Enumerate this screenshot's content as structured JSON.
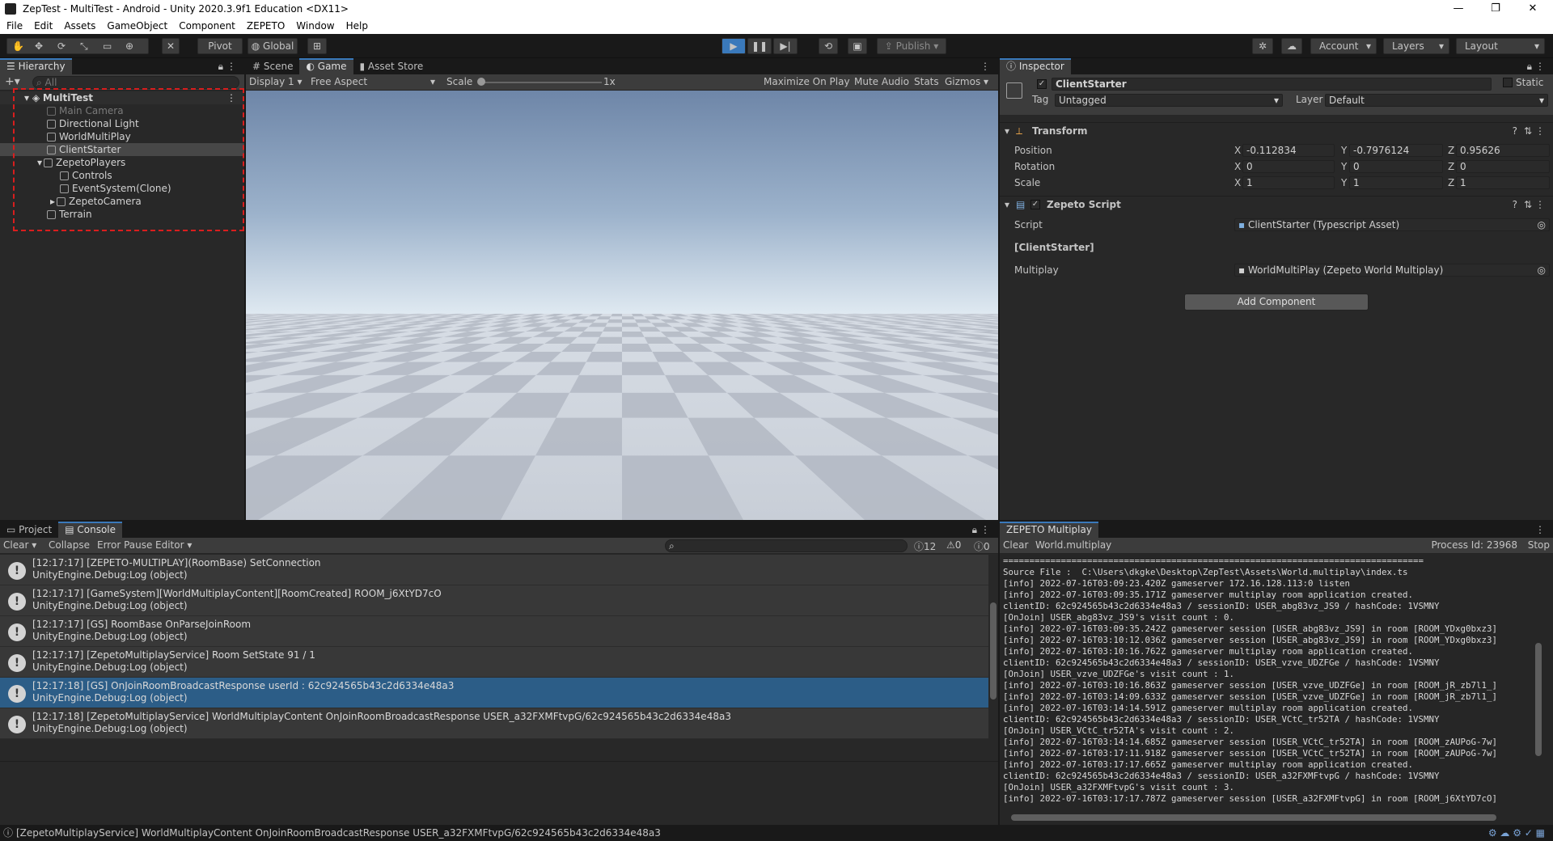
{
  "window": {
    "title": "ZepTest - MultiTest - Android - Unity 2020.3.9f1 Education <DX11>",
    "controls": [
      "—",
      "❐",
      "✕"
    ]
  },
  "menu": [
    "File",
    "Edit",
    "Assets",
    "GameObject",
    "Component",
    "ZEPETO",
    "Window",
    "Help"
  ],
  "toolbar": {
    "pivot": "Pivot",
    "global": "Global",
    "publish": "Publish",
    "account": "Account",
    "layers": "Layers",
    "layout": "Layout"
  },
  "hierarchy": {
    "tab": "Hierarchy",
    "search_placeholder": "All",
    "scene": "MultiTest",
    "items": [
      {
        "label": "Main Camera"
      },
      {
        "label": "Directional Light"
      },
      {
        "label": "WorldMultiPlay"
      },
      {
        "label": "ClientStarter"
      },
      {
        "label": "ZepetoPlayers"
      },
      {
        "label": "Controls"
      },
      {
        "label": "EventSystem(Clone)"
      },
      {
        "label": "ZepetoCamera"
      },
      {
        "label": "Terrain"
      }
    ]
  },
  "game_view": {
    "tabs": [
      "Scene",
      "Game",
      "Asset Store"
    ],
    "display": "Display 1",
    "aspect": "Free Aspect",
    "scale_label": "Scale",
    "scale_value": "1x",
    "options": [
      "Maximize On Play",
      "Mute Audio",
      "Stats",
      "Gizmos"
    ]
  },
  "inspector": {
    "tab": "Inspector",
    "object_name": "ClientStarter",
    "static_label": "Static",
    "tag_label": "Tag",
    "tag_value": "Untagged",
    "layer_label": "Layer",
    "layer_value": "Default",
    "transform": {
      "title": "Transform",
      "position_label": "Position",
      "rotation_label": "Rotation",
      "scale_label": "Scale",
      "position": {
        "x": "-0.112834",
        "y": "-0.7976124",
        "z": "0.95626"
      },
      "rotation": {
        "x": "0",
        "y": "0",
        "z": "0"
      },
      "scale": {
        "x": "1",
        "y": "1",
        "z": "1"
      }
    },
    "zepeto_script": {
      "title": "Zepeto Script",
      "script_label": "Script",
      "script_value": "ClientStarter (Typescript Asset)",
      "section": "[ClientStarter]",
      "multiplay_label": "Multiplay",
      "multiplay_value": "WorldMultiPlay (Zepeto World Multiplay)"
    },
    "add_component": "Add Component"
  },
  "console": {
    "tabs": [
      "Project",
      "Console"
    ],
    "buttons": [
      "Clear",
      "Collapse",
      "Error Pause",
      "Editor"
    ],
    "counts": {
      "log": "12",
      "warn": "0",
      "error": "0"
    },
    "entries": [
      {
        "line1": "[12:17:17] [ZEPETO-MULTIPLAY](RoomBase) SetConnection",
        "line2": "UnityEngine.Debug:Log (object)"
      },
      {
        "line1": "[12:17:17] [GameSystem][WorldMultiplayContent][RoomCreated] ROOM_j6XtYD7cO",
        "line2": "UnityEngine.Debug:Log (object)"
      },
      {
        "line1": "[12:17:17] [GS] RoomBase OnParseJoinRoom",
        "line2": "UnityEngine.Debug:Log (object)"
      },
      {
        "line1": "[12:17:17] [ZepetoMultiplayService] Room SetState 91 / 1",
        "line2": "UnityEngine.Debug:Log (object)"
      },
      {
        "line1": "[12:17:18] [GS] OnJoinRoomBroadcastResponse userId : 62c924565b43c2d6334e48a3",
        "line2": "UnityEngine.Debug:Log (object)"
      },
      {
        "line1": "[12:17:18] [ZepetoMultiplayService] WorldMultiplayContent OnJoinRoomBroadcastResponse USER_a32FXMFtvpG/62c924565b43c2d6334e48a3",
        "line2": "UnityEngine.Debug:Log (object)"
      }
    ]
  },
  "multiplay": {
    "tab": "ZEPETO Multiplay",
    "clear": "Clear",
    "file": "World.multiplay",
    "process_id": "Process Id: 23968",
    "stop": "Stop",
    "lines": [
      "================================================================================",
      "Source File :  C:\\Users\\dkgke\\Desktop\\ZepTest\\Assets\\World.multiplay\\index.ts",
      "[info] 2022-07-16T03:09:23.420Z gameserver 172.16.128.113:0 listen",
      "[info] 2022-07-16T03:09:35.171Z gameserver multiplay room application created.",
      "clientID: 62c924565b43c2d6334e48a3 / sessionID: USER_abg83vz_JS9 / hashCode: 1VSMNY",
      "[OnJoin] USER_abg83vz_JS9's visit count : 0.",
      "[info] 2022-07-16T03:09:35.242Z gameserver session [USER_abg83vz_JS9] in room [ROOM_YDxg0bxz3]",
      "[info] 2022-07-16T03:10:12.036Z gameserver session [USER_abg83vz_JS9] in room [ROOM_YDxg0bxz3]",
      "[info] 2022-07-16T03:10:16.762Z gameserver multiplay room application created.",
      "clientID: 62c924565b43c2d6334e48a3 / sessionID: USER_vzve_UDZFGe / hashCode: 1VSMNY",
      "[OnJoin] USER_vzve_UDZFGe's visit count : 1.",
      "[info] 2022-07-16T03:10:16.863Z gameserver session [USER_vzve_UDZFGe] in room [ROOM_jR_zb7l1_]",
      "[info] 2022-07-16T03:14:09.633Z gameserver session [USER_vzve_UDZFGe] in room [ROOM_jR_zb7l1_]",
      "[info] 2022-07-16T03:14:14.591Z gameserver multiplay room application created.",
      "clientID: 62c924565b43c2d6334e48a3 / sessionID: USER_VCtC_tr52TA / hashCode: 1VSMNY",
      "[OnJoin] USER_VCtC_tr52TA's visit count : 2.",
      "[info] 2022-07-16T03:14:14.685Z gameserver session [USER_VCtC_tr52TA] in room [ROOM_zAUPoG-7w]",
      "[info] 2022-07-16T03:17:11.918Z gameserver session [USER_VCtC_tr52TA] in room [ROOM_zAUPoG-7w]",
      "[info] 2022-07-16T03:17:17.665Z gameserver multiplay room application created.",
      "clientID: 62c924565b43c2d6334e48a3 / sessionID: USER_a32FXMFtvpG / hashCode: 1VSMNY",
      "[OnJoin] USER_a32FXMFtvpG's visit count : 3.",
      "[info] 2022-07-16T03:17:17.787Z gameserver session [USER_a32FXMFtvpG] in room [ROOM_j6XtYD7cO]"
    ]
  },
  "status_bar": "[ZepetoMultiplayService] WorldMultiplayContent OnJoinRoomBroadcastResponse USER_a32FXMFtvpG/62c924565b43c2d6334e48a3",
  "colors": {
    "selection": "#2c5d87",
    "highlight_box": "#d91e1e",
    "tab_accent": "#3a79bb"
  }
}
